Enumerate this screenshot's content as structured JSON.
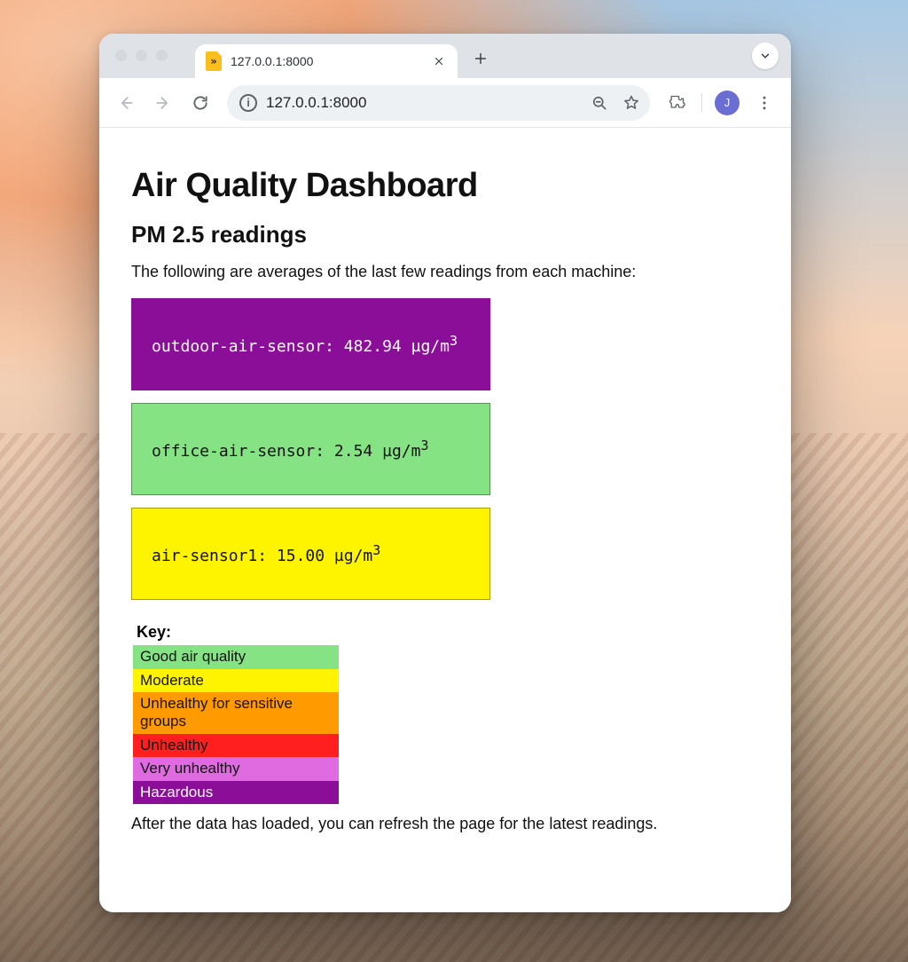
{
  "browser": {
    "tab_title": "127.0.0.1:8000",
    "url": "127.0.0.1:8000",
    "avatar_initial": "J",
    "favicon_glyph": "»"
  },
  "page": {
    "title": "Air Quality Dashboard",
    "subtitle": "PM 2.5 readings",
    "intro": "The following are averages of the last few readings from each machine:",
    "unit_prefix": " µg/m",
    "unit_sup": "3",
    "readings": [
      {
        "name": "outdoor-air-sensor",
        "value": "482.94",
        "level": "hazardous"
      },
      {
        "name": "office-air-sensor",
        "value": "2.54",
        "level": "good"
      },
      {
        "name": "air-sensor1",
        "value": "15.00",
        "level": "moderate"
      }
    ],
    "key_header": "Key:",
    "key": [
      {
        "label": "Good air quality",
        "level": "good"
      },
      {
        "label": "Moderate",
        "level": "moderate"
      },
      {
        "label": "Unhealthy for sensitive groups",
        "level": "sensitive"
      },
      {
        "label": "Unhealthy",
        "level": "unhealthy"
      },
      {
        "label": "Very unhealthy",
        "level": "very"
      },
      {
        "label": "Hazardous",
        "level": "hazardous"
      }
    ],
    "footer": "After the data has loaded, you can refresh the page for the latest readings."
  }
}
